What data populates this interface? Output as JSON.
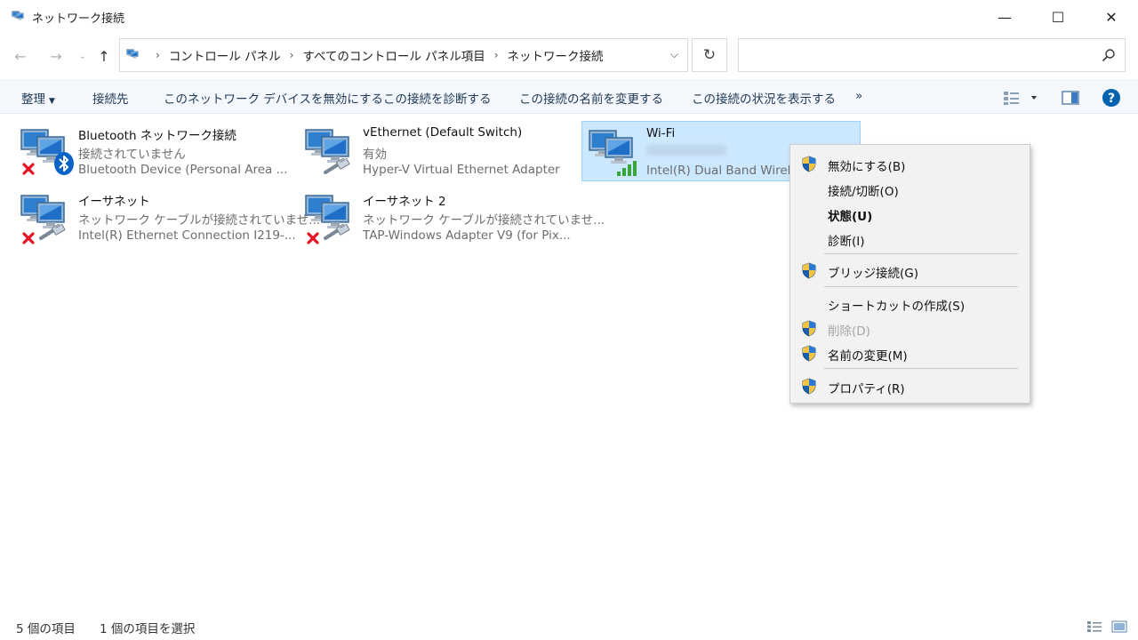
{
  "window": {
    "title": "ネットワーク接続",
    "minimize_glyph": "—",
    "maximize_glyph": "☐",
    "close_glyph": "✕"
  },
  "address": {
    "breadcrumbs": [
      "コントロール パネル",
      "すべてのコントロール パネル項目",
      "ネットワーク接続"
    ],
    "search_placeholder": ""
  },
  "commands": {
    "organize": "整理",
    "connect_to": "接続先",
    "disable_device": "このネットワーク デバイスを無効にする",
    "diagnose": "この接続を診断する",
    "rename": "この接続の名前を変更する",
    "view_status": "この接続の状況を表示する",
    "more": "»",
    "help": "?"
  },
  "connections": [
    {
      "name": "Bluetooth ネットワーク接続",
      "status": "接続されていません",
      "device": "Bluetooth Device (Personal Area ...",
      "icon": "bluetooth-adapter-icon",
      "overlay": "red-x-icon"
    },
    {
      "name": "vEthernet (Default Switch)",
      "status": "有効",
      "device": "Hyper-V Virtual Ethernet Adapter",
      "icon": "ethernet-adapter-icon",
      "overlay": ""
    },
    {
      "name": "Wi-Fi",
      "status": "",
      "device": "Intel(R) Dual Band Wirele",
      "icon": "wifi-adapter-icon",
      "overlay": "signal-bars-icon",
      "selected": true
    },
    {
      "name": "イーサネット",
      "status": "ネットワーク ケーブルが接続されていませ...",
      "device": "Intel(R) Ethernet Connection I219-...",
      "icon": "ethernet-adapter-icon",
      "overlay": "red-x-icon"
    },
    {
      "name": "イーサネット 2",
      "status": "ネットワーク ケーブルが接続されていませ...",
      "device": "TAP-Windows Adapter V9 (for Pix...",
      "icon": "ethernet-adapter-icon",
      "overlay": "red-x-icon"
    }
  ],
  "context_menu": [
    {
      "label": "無効にする(B)",
      "shield": true
    },
    {
      "label": "接続/切断(O)",
      "shield": false
    },
    {
      "label": "状態(U)",
      "shield": false,
      "bold": true
    },
    {
      "label": "診断(I)",
      "shield": false
    },
    {
      "label": "ブリッジ接続(G)",
      "shield": true
    },
    {
      "label": "ショートカットの作成(S)",
      "shield": false
    },
    {
      "label": "削除(D)",
      "shield": true,
      "disabled": true
    },
    {
      "label": "名前の変更(M)",
      "shield": true
    },
    {
      "label": "プロパティ(R)",
      "shield": true
    }
  ],
  "statusbar": {
    "item_count": "5 個の項目",
    "selected_count": "1 個の項目を選択"
  },
  "colors": {
    "accent": "#0063b1",
    "selection_bg": "#cce8ff",
    "selection_border": "#99d1ff",
    "command_text": "#1e3957",
    "error_red": "#e81123",
    "signal_green": "#3aa53a"
  }
}
